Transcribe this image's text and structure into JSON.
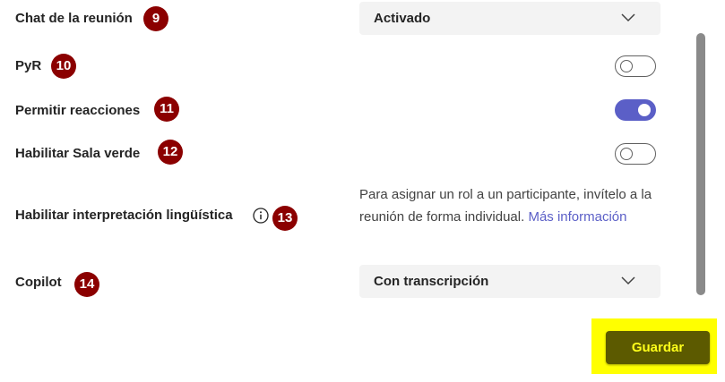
{
  "settings": {
    "chat": {
      "label": "Chat de la reunión",
      "badge": "9",
      "value": "Activado"
    },
    "qa": {
      "label": "PyR",
      "badge": "10",
      "enabled": false
    },
    "reactions": {
      "label": "Permitir reacciones",
      "badge": "11",
      "enabled": true
    },
    "green_room": {
      "label": "Habilitar Sala verde",
      "badge": "12",
      "enabled": false
    },
    "interpretation": {
      "label": "Habilitar interpretación lingüística",
      "badge": "13",
      "info_text": "Para asignar un rol a un participante, invítelo a la reunión de forma individual.",
      "link_text": "Más información"
    },
    "copilot": {
      "label": "Copilot",
      "badge": "14",
      "value": "Con transcripción"
    }
  },
  "footer": {
    "save_label": "Guardar"
  },
  "colors": {
    "toggle_on": "#5b5fc7",
    "badge": "#8b0000",
    "highlight": "#ffff00",
    "save_button": "#5c5a00",
    "link": "#5b5fc7"
  },
  "icons": {
    "chevron": "chevron-down-icon",
    "info": "info-icon"
  }
}
